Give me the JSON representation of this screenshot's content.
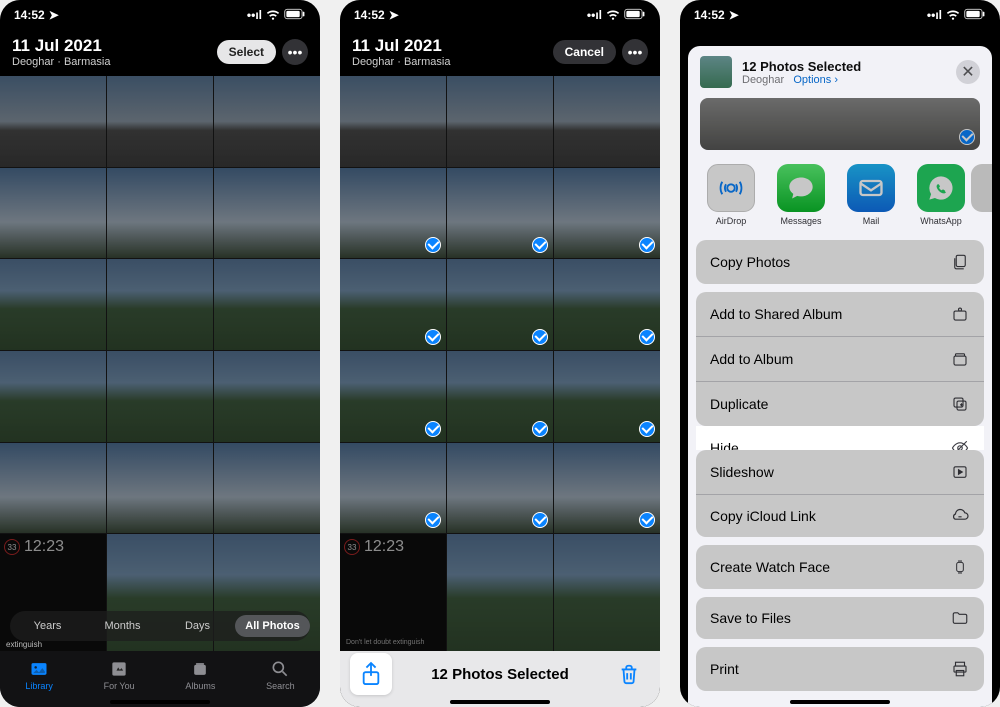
{
  "status": {
    "time": "14:52",
    "loc_arrow": "↗"
  },
  "header": {
    "date": "11 Jul 2021",
    "location": "Deoghar · Barmasia",
    "select_label": "Select",
    "cancel_label": "Cancel",
    "more_glyph": "•••"
  },
  "segmented": {
    "items": [
      "Years",
      "Months",
      "Days",
      "All Photos"
    ],
    "extinguish": "extinguish"
  },
  "clock": {
    "badge": "33",
    "time": "12:23",
    "sub": "Don't let doubt\nextinguish"
  },
  "tabs": {
    "library": "Library",
    "foryou": "For You",
    "albums": "Albums",
    "search": "Search"
  },
  "selection_bar": {
    "title": "12 Photos Selected"
  },
  "share_sheet": {
    "title": "12 Photos Selected",
    "subtitle_loc": "Deoghar",
    "options_label": "Options",
    "chevron": "›",
    "close": "✕",
    "apps": [
      {
        "label": "AirDrop"
      },
      {
        "label": "Messages"
      },
      {
        "label": "Mail"
      },
      {
        "label": "WhatsApp"
      }
    ],
    "actions": {
      "copy_photos": "Copy Photos",
      "add_shared": "Add to Shared Album",
      "add_album": "Add to Album",
      "duplicate": "Duplicate",
      "hide": "Hide",
      "slideshow": "Slideshow",
      "copy_icloud": "Copy iCloud Link",
      "watchface": "Create Watch Face",
      "save_files": "Save to Files",
      "print": "Print"
    }
  }
}
